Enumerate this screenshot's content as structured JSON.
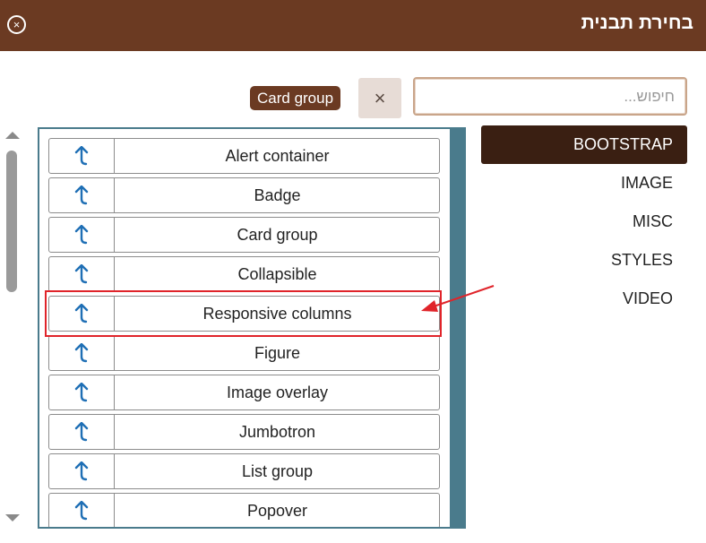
{
  "dialog": {
    "title": "בחירת תבנית",
    "close_glyph": "×"
  },
  "search": {
    "placeholder": "חיפוש...",
    "value": ""
  },
  "clear_button": {
    "glyph": "×"
  },
  "selected_badge": "Card group",
  "templates": [
    {
      "label": "Alert container"
    },
    {
      "label": "Badge"
    },
    {
      "label": "Card group"
    },
    {
      "label": "Collapsible"
    },
    {
      "label": "Responsive columns"
    },
    {
      "label": "Figure"
    },
    {
      "label": "Image overlay"
    },
    {
      "label": "Jumbotron"
    },
    {
      "label": "List group"
    },
    {
      "label": "Popover"
    }
  ],
  "row_icon": "insert-arrow-icon",
  "highlighted_template": "Responsive columns",
  "categories": [
    {
      "label": "BOOTSTRAP",
      "active": true
    },
    {
      "label": "IMAGE",
      "active": false
    },
    {
      "label": "MISC",
      "active": false
    },
    {
      "label": "STYLES",
      "active": false
    },
    {
      "label": "VIDEO",
      "active": false
    }
  ],
  "colors": {
    "header_bg": "#6b3a22",
    "badge_bg": "#6b3a22",
    "active_category_bg": "#3a1f12",
    "list_border": "#4a7b8c",
    "icon_blue": "#1f6fb5",
    "annotation_red": "#e0242a"
  }
}
